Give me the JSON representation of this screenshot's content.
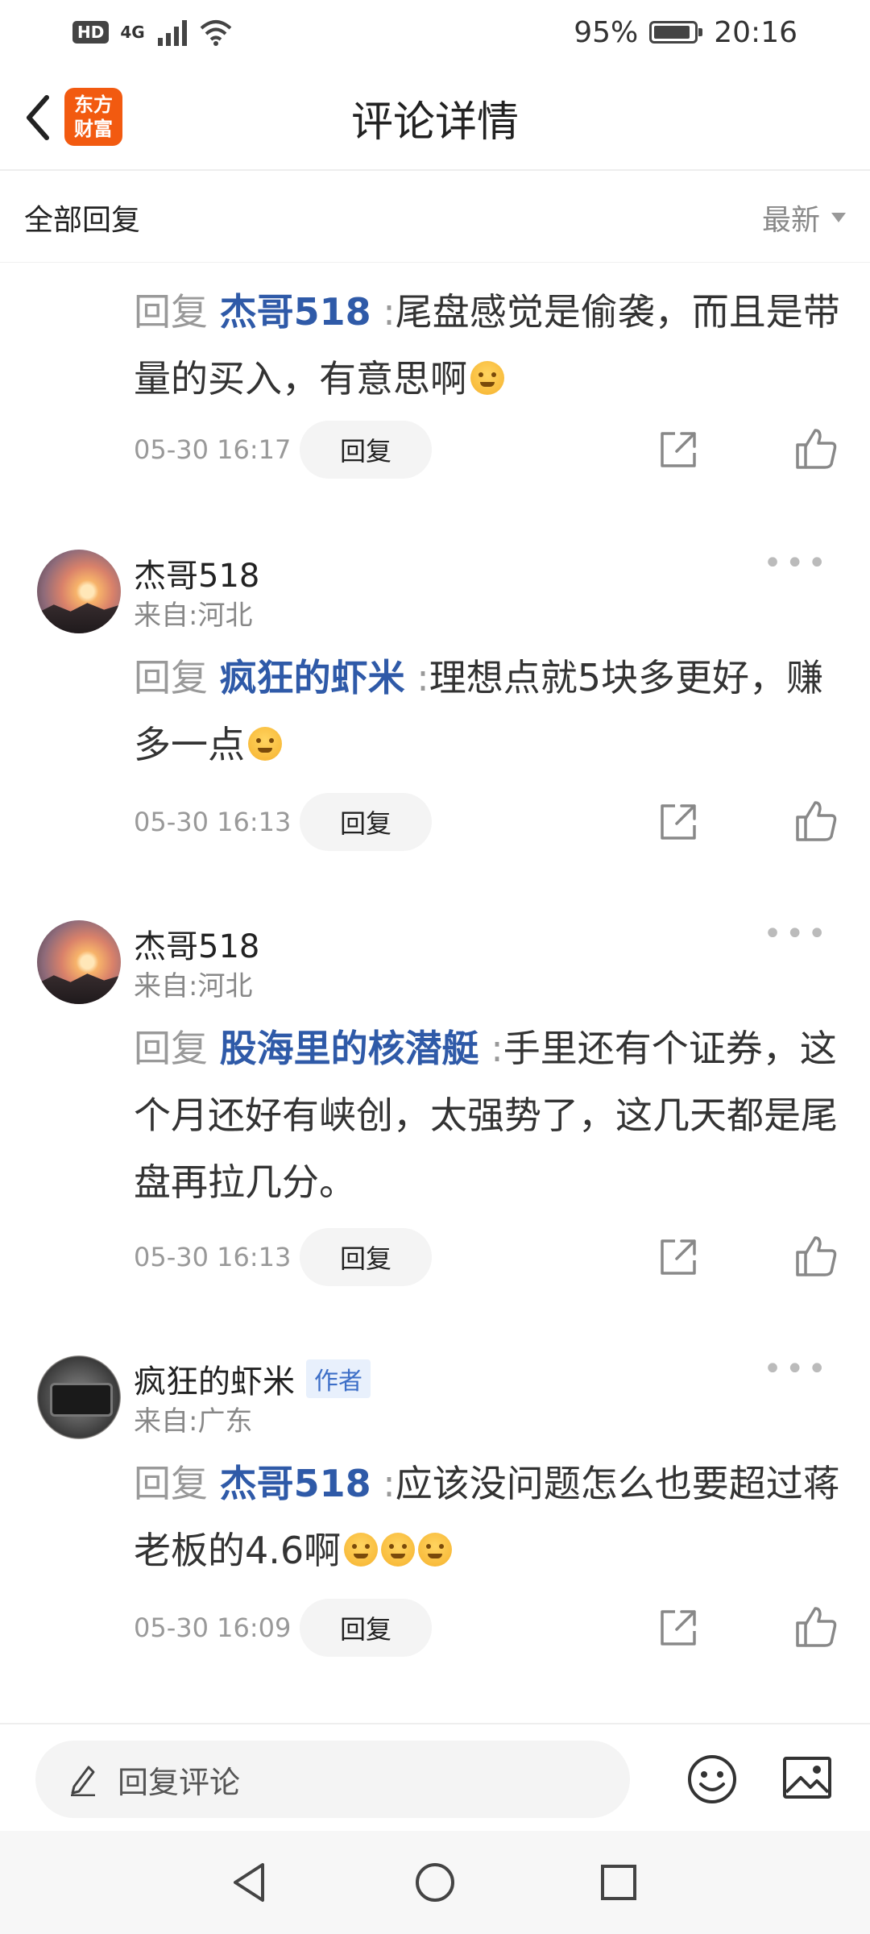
{
  "status_bar": {
    "hd_label": "HD",
    "network": "4G",
    "battery_percent": "95%",
    "time": "20:16"
  },
  "header": {
    "logo_line1": "东方",
    "logo_line2": "财富",
    "title": "评论详情"
  },
  "subheader": {
    "all_replies_label": "全部回复",
    "sort_label": "最新"
  },
  "comments": [
    {
      "reply_prefix": "回复",
      "mention": "杰哥518",
      "separator": ":",
      "text": "尾盘感觉是偷袭，而且是带量的买入，有意思啊",
      "emoji_count": 1,
      "timestamp": "05-30 16:17",
      "reply_button": "回复"
    },
    {
      "username": "杰哥518",
      "location": "来自:河北",
      "reply_prefix": "回复",
      "mention": "疯狂的虾米",
      "separator": ":",
      "text": "理想点就5块多更好，赚多一点",
      "emoji_count": 1,
      "timestamp": "05-30 16:13",
      "reply_button": "回复"
    },
    {
      "username": "杰哥518",
      "location": "来自:河北",
      "reply_prefix": "回复",
      "mention": "股海里的核潜艇",
      "separator": ":",
      "text": "手里还有个证券，这个月还好有峡创，太强势了，这几天都是尾盘再拉几分。",
      "emoji_count": 0,
      "timestamp": "05-30 16:13",
      "reply_button": "回复"
    },
    {
      "username": "疯狂的虾米",
      "author_badge": "作者",
      "location": "来自:广东",
      "reply_prefix": "回复",
      "mention": "杰哥518",
      "separator": ":",
      "text": "应该没问题怎么也要超过蒋老板的4.6啊",
      "emoji_count": 3,
      "timestamp": "05-30 16:09",
      "reply_button": "回复"
    }
  ],
  "input_bar": {
    "placeholder": "回复评论"
  },
  "icons": {
    "back": "chevron-left-icon",
    "share": "share-icon",
    "like": "thumbs-up-icon",
    "more": "more-dots-icon",
    "edit": "pencil-icon",
    "emoji": "smiley-icon",
    "image": "image-icon"
  },
  "colors": {
    "brand": "#f25a10",
    "mention": "#2f5aa8",
    "muted": "#999999"
  }
}
